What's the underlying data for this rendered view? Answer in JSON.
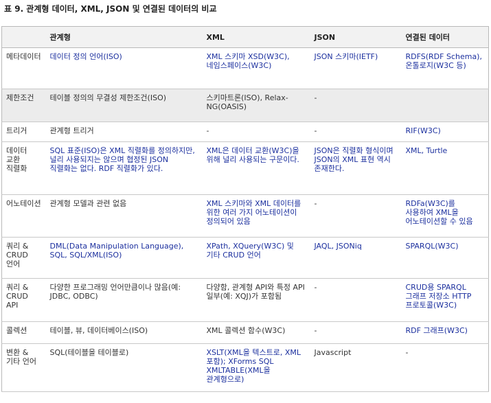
{
  "caption": "표 9. 관계형 데이터, XML, JSON 및 연결된 데이터의 비교",
  "header": [
    "",
    "관계형",
    "XML",
    "JSON",
    "연결된 데이터"
  ],
  "rows": [
    {
      "label": "메타데이터",
      "rel": "데이터 정의 언어(ISO)",
      "xml": "XML 스키마 XSD(W3C), 네임스페이스(W3C)",
      "json": "JSON 스키마(IETF)",
      "ld": "RDFS(RDF Schema), 온톨로지(W3C 등)"
    },
    {
      "label": "제한조건",
      "rel": "테이블 정의의 무결성 제한조건(ISO)",
      "xml": "스키마트론(ISO), Relax-NG(OASIS)",
      "json": "-",
      "ld": ""
    },
    {
      "label": "트리거",
      "rel": "관계형 트리거",
      "xml": "-",
      "json": "-",
      "ld": "RIF(W3C)"
    },
    {
      "label": "데이터 교환 직렬화",
      "rel": "SQL 표준(ISO)은 XML 직렬화를 정의하지만, 널리 사용되지는 않으며 협정된 JSON 직렬화는 없다. RDF 직렬화가 있다.",
      "xml": "XML은 데이터 교환(W3C)을 위해 널리 사용되는 구문이다.",
      "json": "JSON은 직렬화 형식이며 JSON의 XML 표현 역시 존재한다.",
      "ld": "XML, Turtle"
    },
    {
      "label": "어노테이션",
      "rel": "관계형 모델과 관련 없음",
      "xml": "XML 스키마와 XML 데이터를 위한 여러 가지 어노테이션이 정의되어 있음",
      "json": "-",
      "ld": "RDFa(W3C)를 사용하여 XML을 어노테이션할 수 있음"
    },
    {
      "label": "쿼리 & CRUD 언어",
      "rel": "DML(Data Manipulation Language), SQL, SQL/XML(ISO)",
      "xml": "XPath, XQuery(W3C) 및 기타 CRUD 언어",
      "json": "JAQL, JSONiq",
      "ld": "SPARQL(W3C)"
    },
    {
      "label": "쿼리 & CRUD API",
      "rel": "다양한 프로그래밍 언어만큼이나 많음(예: JDBC, ODBC)",
      "xml": "다양함, 관계형 API와 특정 API 일부(예: XQJ)가 포함됨",
      "json": "-",
      "ld": "CRUD용 SPARQL 그래프 저장소 HTTP 프로토콜(W3C)"
    },
    {
      "label": "콜렉션",
      "rel": "테이블, 뷰, 데이터베이스(ISO)",
      "xml": "XML 콜렉션 함수(W3C)",
      "json": "-",
      "ld": "RDF 그래프(W3C)"
    },
    {
      "label": "변환 & 기타 언어",
      "rel": "SQL(테이블을 테이블로)",
      "xml": "XSLT(XML을 텍스트로, XML 포함); XForms SQL XMLTABLE(XML을 관계형으로)",
      "json": "Javascript",
      "ld": "-"
    }
  ]
}
